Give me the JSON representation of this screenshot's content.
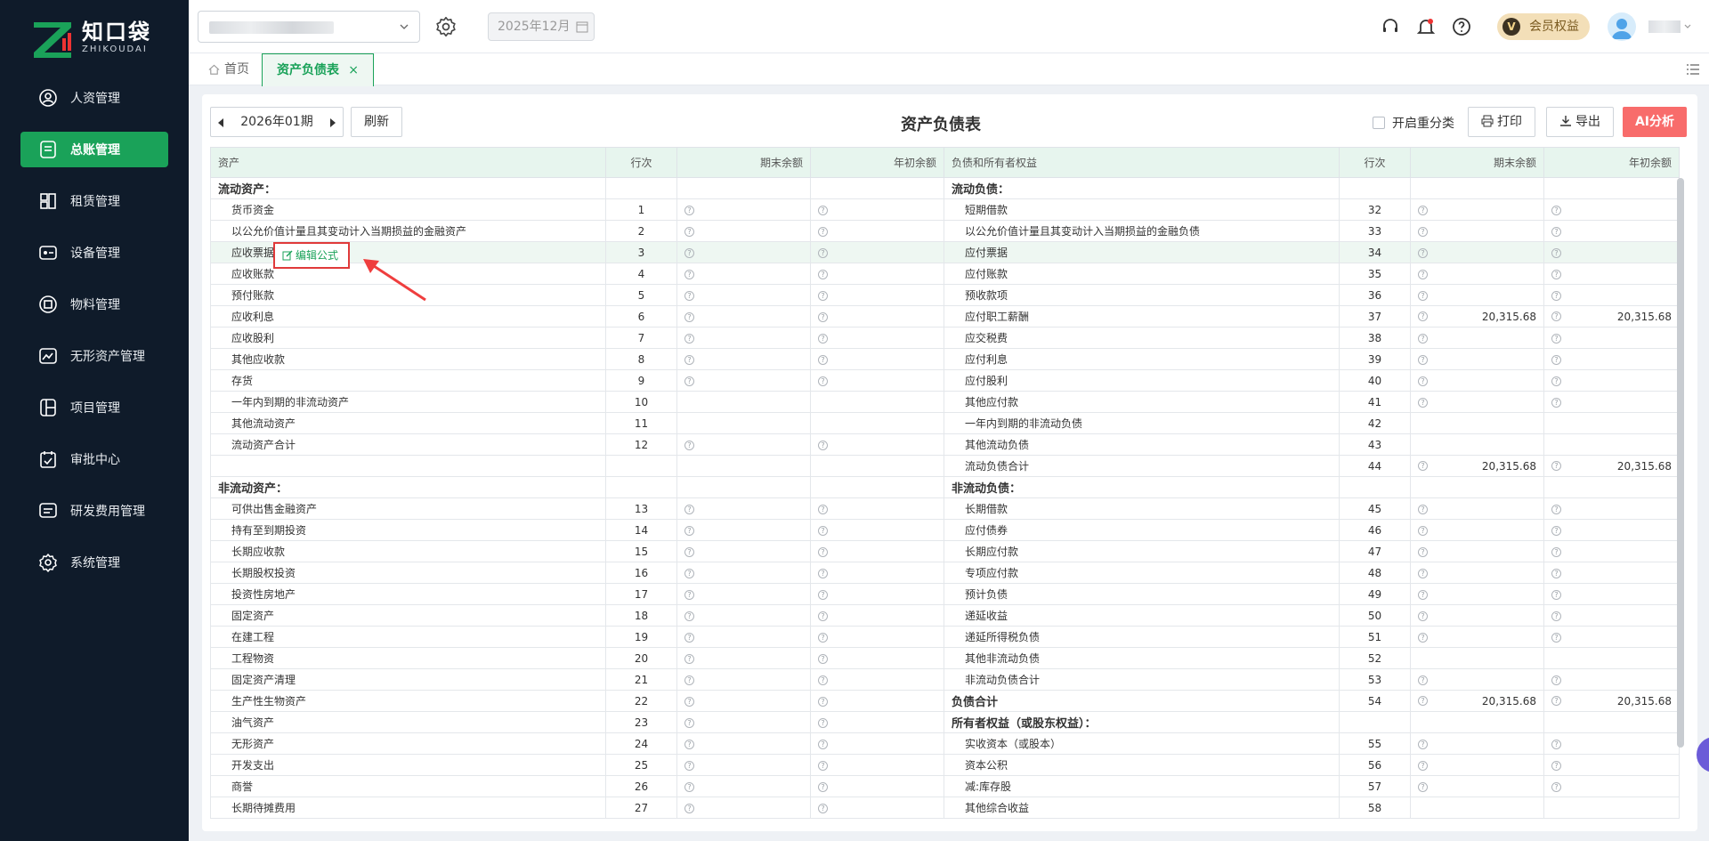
{
  "app": {
    "logo_cn": "知口袋",
    "logo_en": "ZHIKOUDAI",
    "accent": "#1aa259",
    "sidebar_bg": "#0f1b2a"
  },
  "sidebar": {
    "items": [
      {
        "label": "人资管理",
        "icon": "person-icon"
      },
      {
        "label": "总账管理",
        "icon": "ledger-icon",
        "active": true
      },
      {
        "label": "租赁管理",
        "icon": "lease-icon"
      },
      {
        "label": "设备管理",
        "icon": "equipment-icon"
      },
      {
        "label": "物料管理",
        "icon": "material-icon"
      },
      {
        "label": "无形资产管理",
        "icon": "intangible-icon"
      },
      {
        "label": "项目管理",
        "icon": "project-icon"
      },
      {
        "label": "审批中心",
        "icon": "approval-icon"
      },
      {
        "label": "研发费用管理",
        "icon": "rd-icon"
      },
      {
        "label": "系统管理",
        "icon": "settings-icon"
      }
    ]
  },
  "topbar": {
    "date": "2025年12月",
    "vip_label": "会员权益",
    "vip_badge": "V"
  },
  "tabs": {
    "home": "首页",
    "active": "资产负债表",
    "close": "×"
  },
  "toolbar": {
    "period": "2026年01期",
    "refresh": "刷新",
    "title": "资产负债表",
    "reclass": "开启重分类",
    "print": "打印",
    "export": "导出",
    "ai": "AI分析"
  },
  "table": {
    "headers": [
      "资产",
      "行次",
      "期末余额",
      "年初余额",
      "负债和所有者权益",
      "行次",
      "期末余额",
      "年初余额"
    ],
    "rows": [
      {
        "la": "流动资产：",
        "lsec": true,
        "ln": "",
        "lq": false,
        "ra": "流动负债：",
        "rsec": true,
        "rn": "",
        "rq": false
      },
      {
        "la": "货币资金",
        "ln": "1",
        "lq": true,
        "ra": "短期借款",
        "rn": "32",
        "rq": true
      },
      {
        "la": "以公允价值计量且其变动计入当期损益的金融资产",
        "ln": "2",
        "lq": true,
        "ra": "以公允价值计量且其变动计入当期损益的金融负债",
        "rn": "33",
        "rq": true
      },
      {
        "la": "应收票据",
        "ln": "3",
        "lq": true,
        "ra": "应付票据",
        "rn": "34",
        "rq": true,
        "hl": true
      },
      {
        "la": "应收账款",
        "ln": "4",
        "lq": true,
        "ra": "应付账款",
        "rn": "35",
        "rq": true
      },
      {
        "la": "预付账款",
        "ln": "5",
        "lq": true,
        "ra": "预收款项",
        "rn": "36",
        "rq": true
      },
      {
        "la": "应收利息",
        "ln": "6",
        "lq": true,
        "ra": "应付职工薪酬",
        "rn": "37",
        "rq": true,
        "re": "20,315.68",
        "rb": "20,315.68"
      },
      {
        "la": "应收股利",
        "ln": "7",
        "lq": true,
        "ra": "应交税费",
        "rn": "38",
        "rq": true
      },
      {
        "la": "其他应收款",
        "ln": "8",
        "lq": true,
        "ra": "应付利息",
        "rn": "39",
        "rq": true
      },
      {
        "la": "存货",
        "ln": "9",
        "lq": true,
        "ra": "应付股利",
        "rn": "40",
        "rq": true
      },
      {
        "la": "一年内到期的非流动资产",
        "ln": "10",
        "lq": false,
        "ra": "其他应付款",
        "rn": "41",
        "rq": true
      },
      {
        "la": "其他流动资产",
        "ln": "11",
        "lq": false,
        "ra": "一年内到期的非流动负债",
        "rn": "42",
        "rq": false
      },
      {
        "la": "流动资产合计",
        "ln": "12",
        "lq": true,
        "ra": "其他流动负债",
        "rn": "43",
        "rq": false
      },
      {
        "la": "",
        "ln": "",
        "lq": false,
        "ra": "流动负债合计",
        "rn": "44",
        "rq": true,
        "re": "20,315.68",
        "rb": "20,315.68"
      },
      {
        "la": "非流动资产：",
        "lsec": true,
        "ln": "",
        "lq": false,
        "ra": "非流动负债：",
        "rsec": true,
        "rn": "",
        "rq": false
      },
      {
        "la": "可供出售金融资产",
        "ln": "13",
        "lq": true,
        "ra": "长期借款",
        "rn": "45",
        "rq": true
      },
      {
        "la": "持有至到期投资",
        "ln": "14",
        "lq": true,
        "ra": "应付债券",
        "rn": "46",
        "rq": true
      },
      {
        "la": "长期应收款",
        "ln": "15",
        "lq": true,
        "ra": "长期应付款",
        "rn": "47",
        "rq": true
      },
      {
        "la": "长期股权投资",
        "ln": "16",
        "lq": true,
        "ra": "专项应付款",
        "rn": "48",
        "rq": true
      },
      {
        "la": "投资性房地产",
        "ln": "17",
        "lq": true,
        "ra": "预计负债",
        "rn": "49",
        "rq": true
      },
      {
        "la": "固定资产",
        "ln": "18",
        "lq": true,
        "ra": "递延收益",
        "rn": "50",
        "rq": true
      },
      {
        "la": "在建工程",
        "ln": "19",
        "lq": true,
        "ra": "递延所得税负债",
        "rn": "51",
        "rq": true
      },
      {
        "la": "工程物资",
        "ln": "20",
        "lq": true,
        "ra": "其他非流动负债",
        "rn": "52",
        "rq": false
      },
      {
        "la": "固定资产清理",
        "ln": "21",
        "lq": true,
        "ra": "非流动负债合计",
        "rn": "53",
        "rq": true
      },
      {
        "la": "生产性生物资产",
        "ln": "22",
        "lq": true,
        "ra": "负债合计",
        "rsec": true,
        "rn": "54",
        "rq": true,
        "re": "20,315.68",
        "rb": "20,315.68"
      },
      {
        "la": "油气资产",
        "ln": "23",
        "lq": true,
        "ra": "所有者权益（或股东权益）：",
        "rsec": true,
        "rn": "",
        "rq": false
      },
      {
        "la": "无形资产",
        "ln": "24",
        "lq": true,
        "ra": "实收资本（或股本）",
        "rn": "55",
        "rq": true
      },
      {
        "la": "开发支出",
        "ln": "25",
        "lq": true,
        "ra": "资本公积",
        "rn": "56",
        "rq": true
      },
      {
        "la": "商誉",
        "ln": "26",
        "lq": true,
        "ra": "减:库存股",
        "rn": "57",
        "rq": true
      },
      {
        "la": "长期待摊费用",
        "ln": "27",
        "lq": true,
        "ra": "其他综合收益",
        "rn": "58",
        "rq": false
      }
    ]
  },
  "popup": {
    "edit_formula": "编辑公式"
  }
}
